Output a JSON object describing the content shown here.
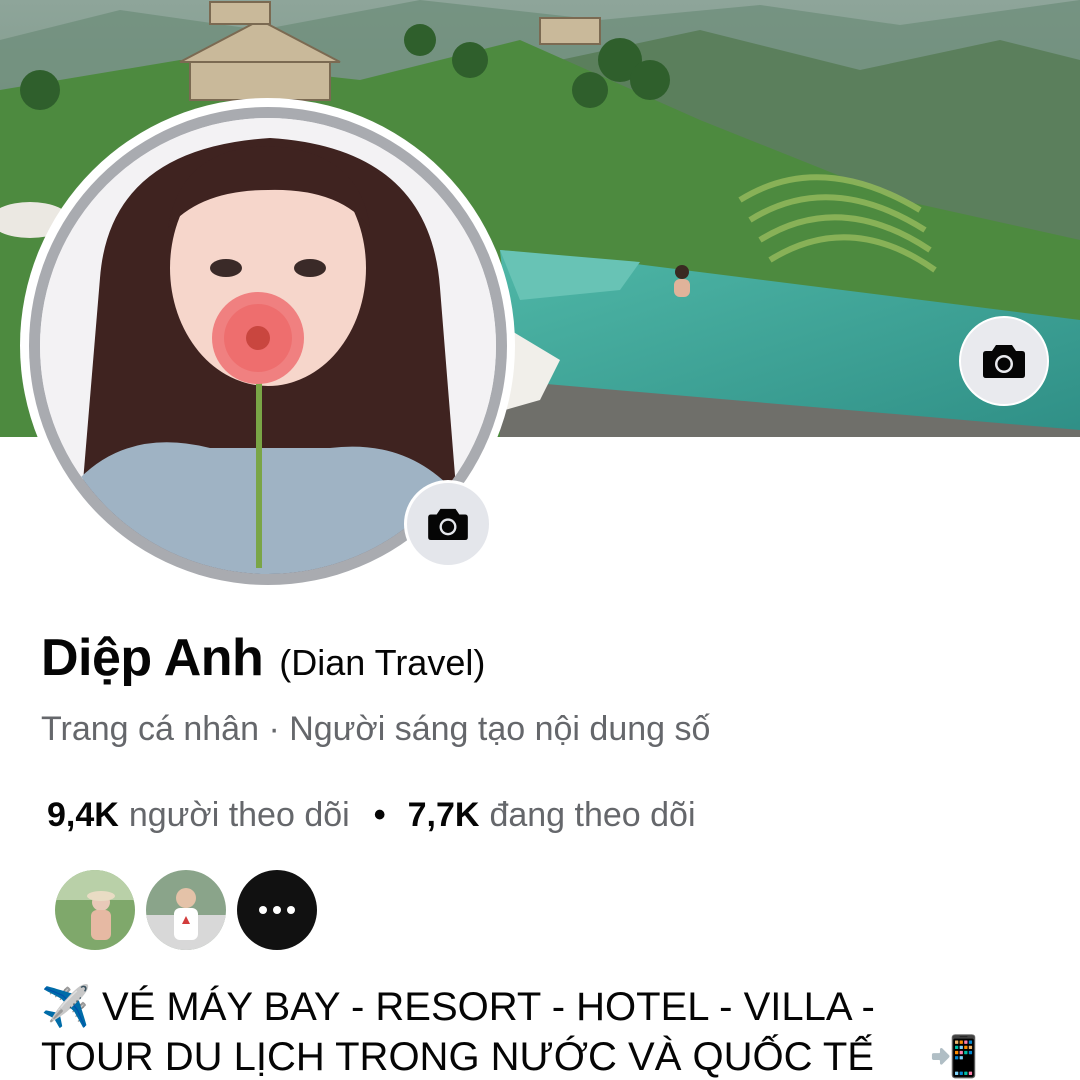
{
  "profile": {
    "name": "Diệp Anh",
    "alt_name": "(Dian Travel)",
    "subtitle": "Trang cá nhân · Người sáng tạo nội dung số"
  },
  "stats": {
    "followers_count": "9,4K",
    "followers_label": "người theo dõi",
    "separator": "•",
    "following_count": "7,7K",
    "following_label": "đang theo dõi"
  },
  "bio": {
    "line1_emoji": "✈️",
    "line1_text": "VÉ MÁY BAY - RESORT - HOTEL - VILLA -",
    "line2_text": "TOUR DU LỊCH TRONG NƯỚC VÀ QUỐC TẾ",
    "line2_emoji": "📲"
  },
  "icons": {
    "cover_camera": "camera-icon",
    "avatar_camera": "camera-icon",
    "friends_more": "more-dots-icon"
  },
  "colors": {
    "text_primary": "#050505",
    "text_secondary": "#65676b",
    "button_bg": "#e4e6eb",
    "avatar_ring": "#a9abb0"
  }
}
